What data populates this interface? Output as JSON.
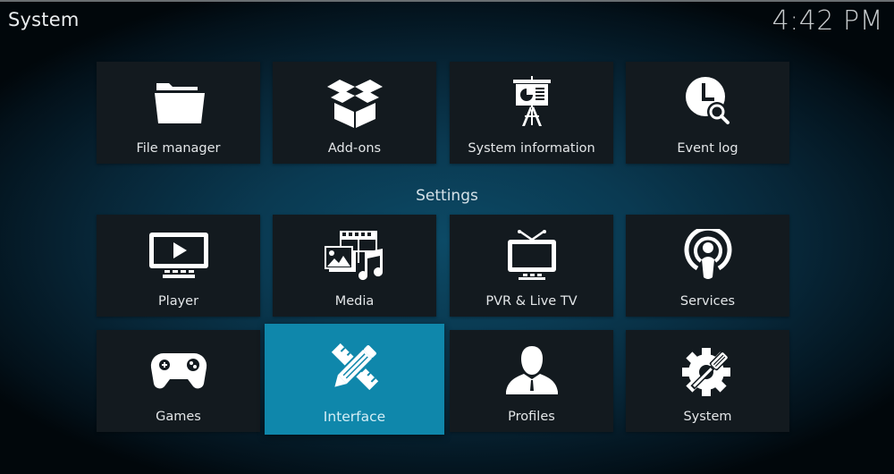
{
  "header": {
    "title": "System",
    "clock": "4:42 PM"
  },
  "top_row": [
    {
      "label": "File manager",
      "icon": "folder-icon"
    },
    {
      "label": "Add-ons",
      "icon": "open-box-icon"
    },
    {
      "label": "System information",
      "icon": "presentation-board-icon"
    },
    {
      "label": "Event log",
      "icon": "clock-search-icon"
    }
  ],
  "settings": {
    "section_label": "Settings",
    "items": [
      {
        "label": "Player",
        "icon": "monitor-play-icon"
      },
      {
        "label": "Media",
        "icon": "media-film-picture-music-icon"
      },
      {
        "label": "PVR & Live TV",
        "icon": "tv-antenna-icon"
      },
      {
        "label": "Services",
        "icon": "podcast-broadcast-icon"
      },
      {
        "label": "Games",
        "icon": "gamepad-icon"
      },
      {
        "label": "Interface",
        "icon": "pencil-ruler-icon",
        "focused": true
      },
      {
        "label": "Profiles",
        "icon": "user-silhouette-icon"
      },
      {
        "label": "System",
        "icon": "gear-screwdriver-icon"
      }
    ]
  },
  "colors": {
    "focus_accent": "#0f87ab",
    "tile_background": "#131a1f",
    "background_center": "#0c4a66"
  }
}
